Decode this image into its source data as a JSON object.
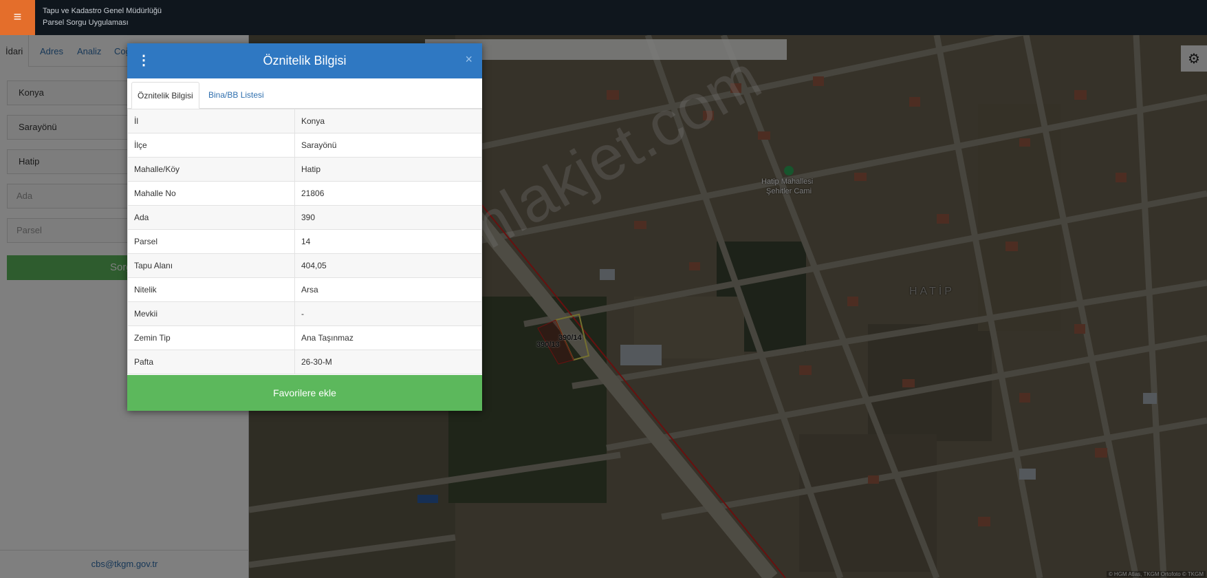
{
  "header": {
    "title_line1": "Tapu ve Kadastro Genel Müdürlüğü",
    "title_line2": "Parsel Sorgu Uygulaması",
    "menu_glyph": "≡"
  },
  "left_panel": {
    "tabs": [
      {
        "label": "İdari",
        "active": true
      },
      {
        "label": "Adres",
        "active": false
      },
      {
        "label": "Analiz",
        "active": false
      },
      {
        "label": "Coğ",
        "active": false
      }
    ],
    "il_value": "Konya",
    "ilce_value": "Sarayönü",
    "mahalle_value": "Hatip",
    "ada_placeholder": "Ada",
    "parsel_placeholder": "Parsel",
    "query_button": "Sorgu",
    "contact_email": "cbs@tkgm.gov.tr"
  },
  "map": {
    "scale_labels": [
      "3998",
      "18"
    ],
    "place_label_1": "Hatip Mahallesi",
    "place_label_2": "Şehitler Cami",
    "district_label": "HATİP",
    "parcel_label_1": "390/14",
    "parcel_label_2": "390/13",
    "watermark": "emlakjet.com",
    "attribution": "© HGM Atlas, TKGM Ortofoto © TKGM",
    "settings_glyph": "⚙"
  },
  "modal": {
    "title": "Öznitelik Bilgisi",
    "close_glyph": "×",
    "kebab_glyph": "⋮",
    "tabs": [
      {
        "label": "Öznitelik Bilgisi",
        "active": true
      },
      {
        "label": "Bina/BB Listesi",
        "active": false
      }
    ],
    "rows": [
      {
        "key": "İl",
        "value": "Konya"
      },
      {
        "key": "İlçe",
        "value": "Sarayönü"
      },
      {
        "key": "Mahalle/Köy",
        "value": "Hatip"
      },
      {
        "key": "Mahalle No",
        "value": "21806"
      },
      {
        "key": "Ada",
        "value": "390"
      },
      {
        "key": "Parsel",
        "value": "14"
      },
      {
        "key": "Tapu Alanı",
        "value": "404,05"
      },
      {
        "key": "Nitelik",
        "value": "Arsa"
      },
      {
        "key": "Mevkii",
        "value": "-"
      },
      {
        "key": "Zemin Tip",
        "value": "Ana Taşınmaz"
      },
      {
        "key": "Pafta",
        "value": "26-30-M"
      }
    ],
    "favorite_button": "Favorilere ekle"
  },
  "colors": {
    "header_bg": "#0f161d",
    "menu_button": "#e46e2b",
    "modal_header": "#2f78c2",
    "primary_green": "#5cb85c",
    "link_blue": "#2f6fae",
    "parcel_outline": "#e8e060",
    "boundary_line": "#d0201e"
  }
}
